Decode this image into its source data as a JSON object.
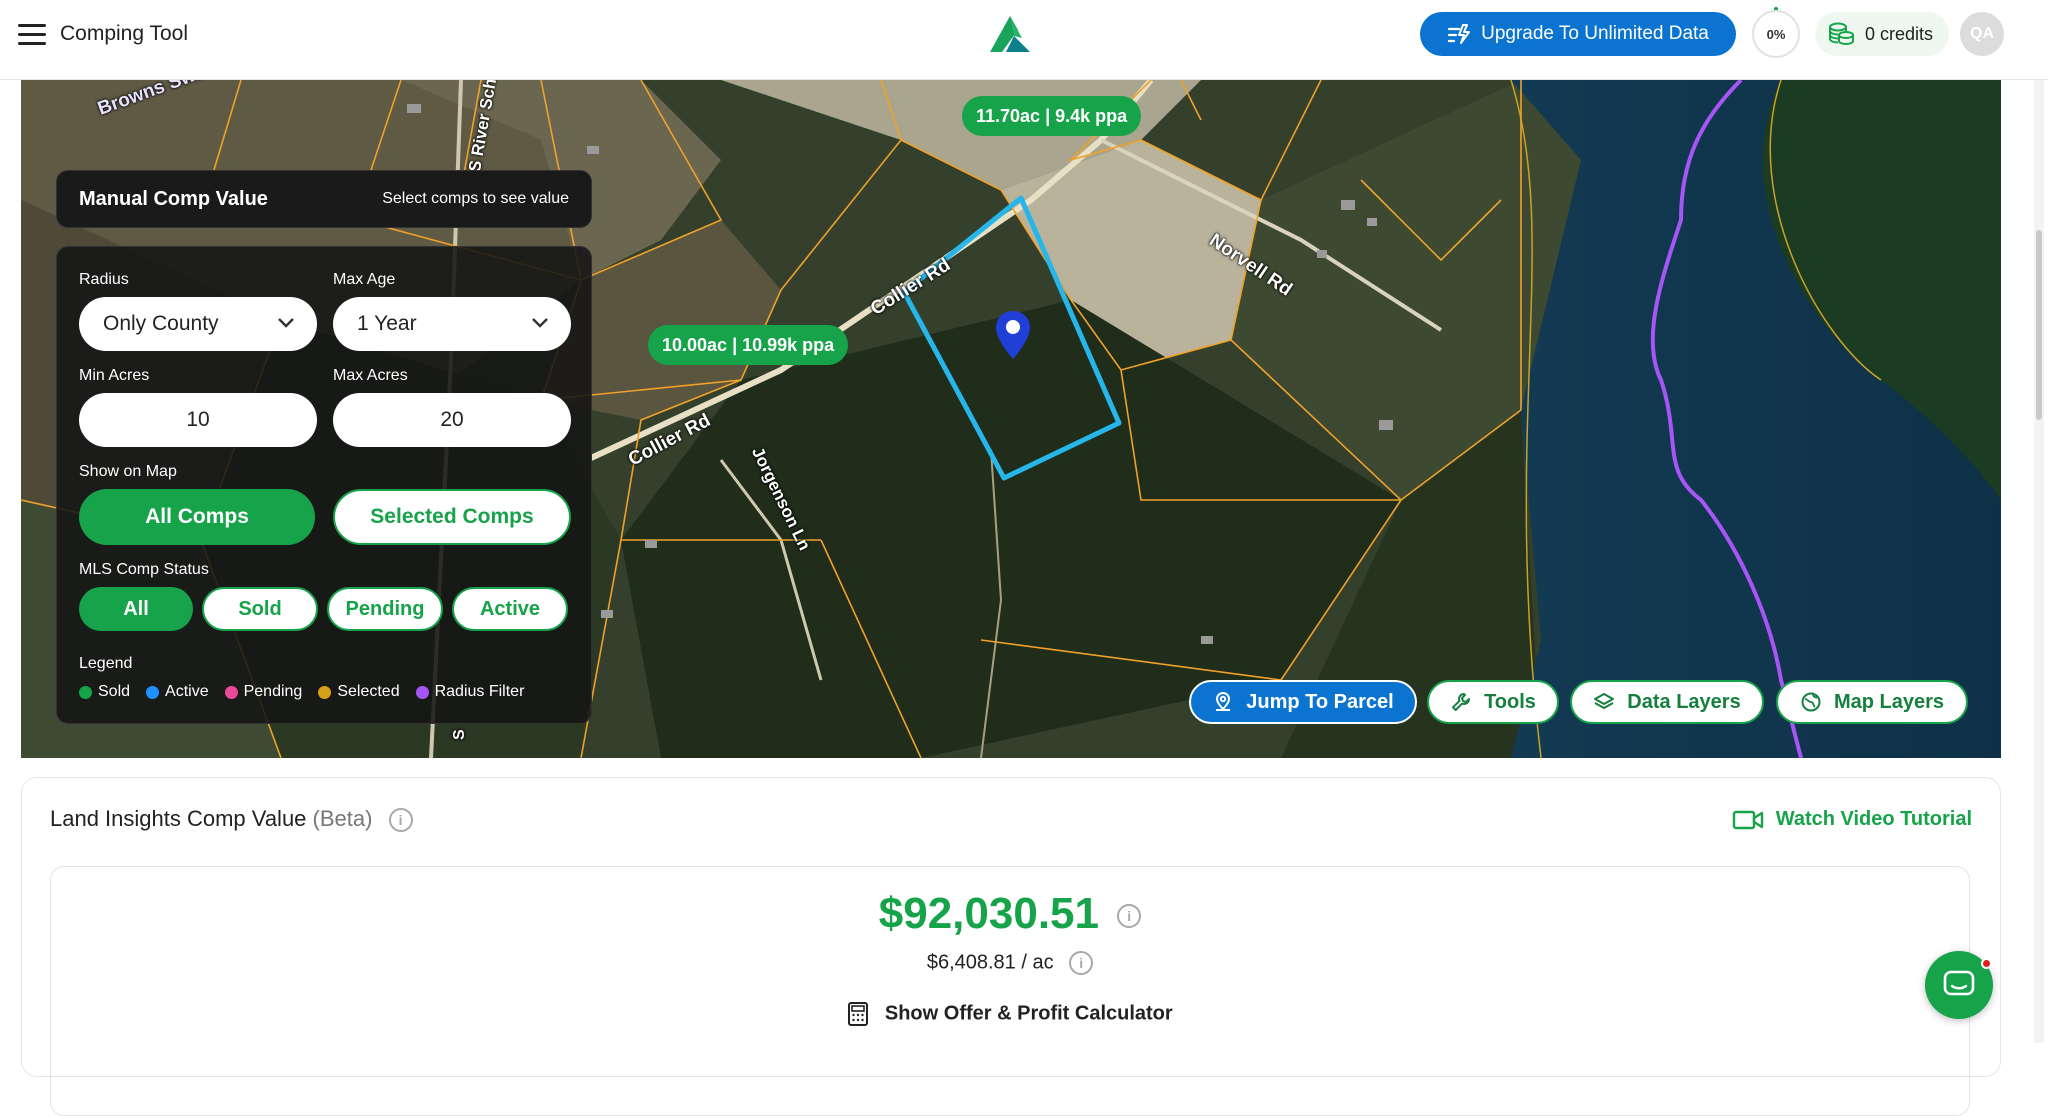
{
  "header": {
    "app_title": "Comping Tool",
    "upgrade_label": "Upgrade To Unlimited Data",
    "progress_label": "0%",
    "progress_value": 0,
    "credits_label": "0 credits",
    "avatar_initials": "QA",
    "brand_color": "#16a34a",
    "accent_color": "#0b74d0"
  },
  "map": {
    "labels": {
      "browns_swamp": "Browns Swamp",
      "river_sch": "S River Sch",
      "collier_rd_1": "Collier Rd",
      "collier_rd_2": "Collier Rd",
      "jorgenson_ln": "Jorgenson Ln",
      "norvell_rd": "Norvell Rd",
      "s_road": "S"
    },
    "comp_pills": [
      {
        "text": "11.70ac | 9.4k ppa"
      },
      {
        "text": "10.00ac | 10.99k ppa"
      }
    ],
    "buttons": {
      "jump": "Jump To Parcel",
      "tools": "Tools",
      "data_layers": "Data Layers",
      "map_layers": "Map Layers"
    }
  },
  "comp_panel": {
    "title": "Manual Comp Value",
    "subtitle": "Select comps to see value",
    "radius_label": "Radius",
    "radius_value": "Only County",
    "max_age_label": "Max Age",
    "max_age_value": "1 Year",
    "min_acres_label": "Min Acres",
    "min_acres_value": "10",
    "max_acres_label": "Max Acres",
    "max_acres_value": "20",
    "show_on_map_label": "Show on Map",
    "show_all": "All Comps",
    "show_selected": "Selected Comps",
    "mls_status_label": "MLS Comp Status",
    "status_chips": [
      "All",
      "Sold",
      "Pending",
      "Active"
    ],
    "legend_label": "Legend",
    "legend": [
      {
        "label": "Sold",
        "color": "#16a34a"
      },
      {
        "label": "Active",
        "color": "#1e90ff"
      },
      {
        "label": "Pending",
        "color": "#ec4899"
      },
      {
        "label": "Selected",
        "color": "#d4a017"
      },
      {
        "label": "Radius Filter",
        "color": "#a855f7"
      }
    ]
  },
  "insights": {
    "title": "Land Insights Comp Value",
    "beta": "(Beta)",
    "tutorial": "Watch Video Tutorial",
    "value": "$92,030.51",
    "per_acre": "$6,408.81 / ac",
    "calculator": "Show Offer & Profit Calculator"
  }
}
